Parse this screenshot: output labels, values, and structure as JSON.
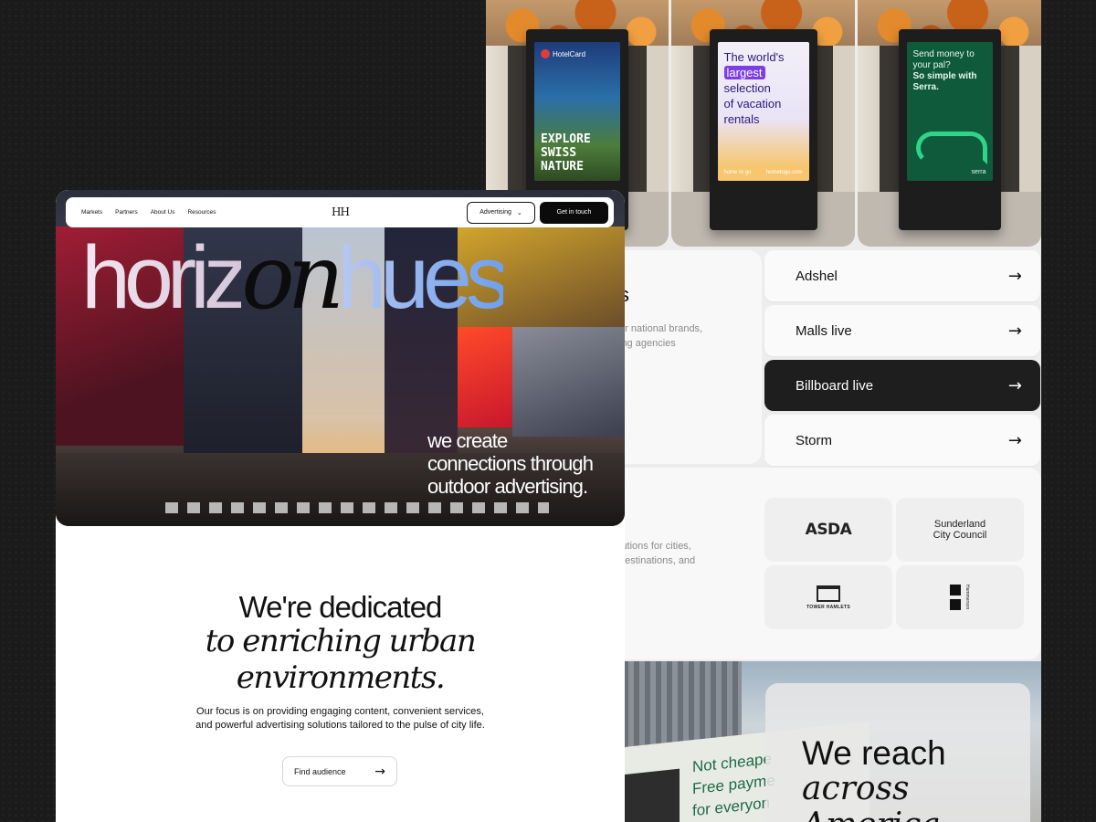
{
  "nav": {
    "links": [
      "Markets",
      "Partners",
      "About Us",
      "Resources"
    ],
    "logo": "HH",
    "advertising_label": "Advertising",
    "cta_label": "Get in touch"
  },
  "hero": {
    "title_part1": "horiz",
    "title_on": "on",
    "title_part3": "hues",
    "subtitle_line1": "we create",
    "subtitle_line2": "connections through",
    "subtitle_line3": "outdoor advertising."
  },
  "mission": {
    "heading": "We're dedicated",
    "italic_line1": "to enriching urban",
    "italic_line2": "environments.",
    "body_line1": "Our focus is on providing engaging content, convenient services,",
    "body_line2": "and powerful advertising solutions tailored to the pulse of city life.",
    "button_label": "Find audience"
  },
  "ads": {
    "hotel": {
      "brand": "HotelCard",
      "line1": "EXPLORE",
      "line2": "SWISS NATURE"
    },
    "home": {
      "line1": "The world's",
      "highlight": "largest",
      "line3": "selection",
      "line4": "of vacation",
      "line5": "rentals",
      "brand": "home to go",
      "url": "hometogo.com"
    },
    "serra": {
      "line1": "Send money to",
      "line2": "your pal?",
      "line3": "So simple with",
      "line4": "Serra.",
      "brand": "serra"
    }
  },
  "about_card": {
    "heading_fragment": "s",
    "text_line1": "or national brands,",
    "text_line2": "ing agencies"
  },
  "menu": {
    "items": [
      {
        "label": "Adshel",
        "active": false
      },
      {
        "label": "Malls live",
        "active": false
      },
      {
        "label": "Billboard live",
        "active": true
      },
      {
        "label": "Storm",
        "active": false
      }
    ]
  },
  "clients": {
    "text_line1": "lutions for cities,",
    "text_line2": "destinations, and",
    "asda": "ASDA",
    "sunderland_line1": "Sunderland",
    "sunderland_line2": "City Council",
    "tower": "TOWER HAMLETS",
    "hammerson": "Hammerson"
  },
  "reach": {
    "truck_line1": "Not cheape",
    "truck_line2": "Free payme",
    "truck_line3": "for everyon",
    "line1": "We reach",
    "line2": "across",
    "line3": "America"
  },
  "colors": {
    "background": "#1b1b1c",
    "accent_dark": "#0b0b0b",
    "menu_active": "#1e1e1e",
    "hues_blue": "#6ea0ef",
    "serra_green": "#0f5a3a"
  }
}
